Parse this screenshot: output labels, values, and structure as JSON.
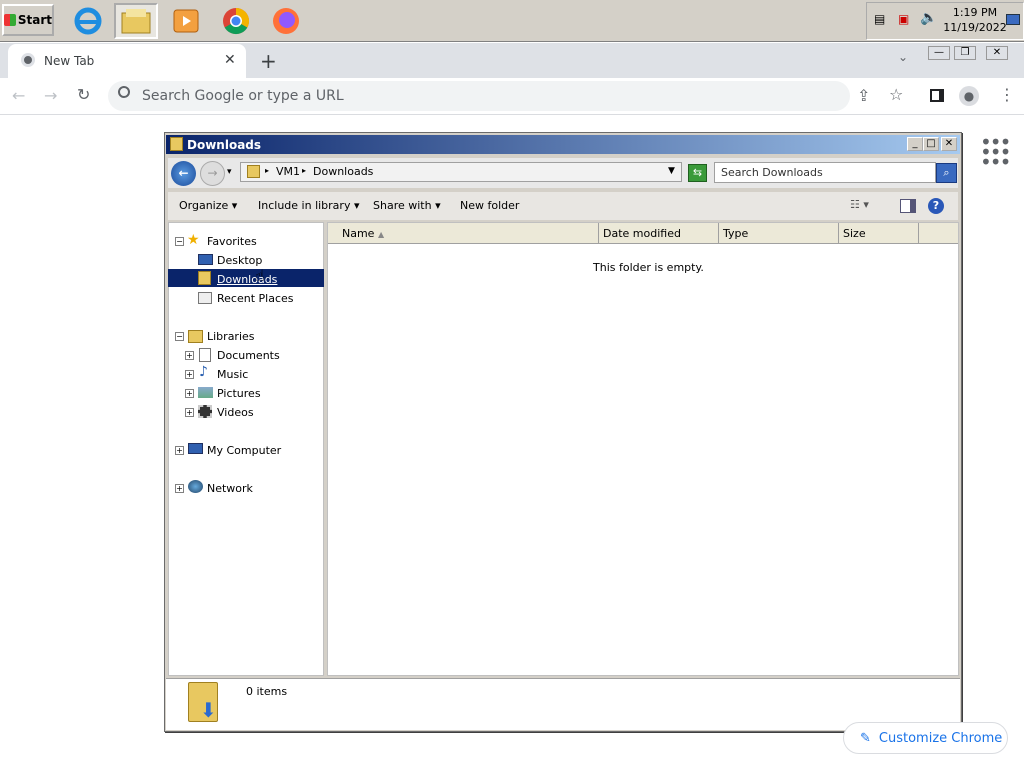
{
  "taskbar": {
    "start_label": "Start",
    "time": "1:19 PM",
    "date": "11/19/2022"
  },
  "chrome": {
    "tab_title": "New Tab",
    "omnibox_placeholder": "Search Google or type a URL",
    "customize_label": "Customize Chrome"
  },
  "explorer": {
    "title": "Downloads",
    "breadcrumb": [
      "VM1",
      "Downloads"
    ],
    "search_placeholder": "Search Downloads",
    "commands": [
      "Organize",
      "Include in library",
      "Share with",
      "New folder"
    ],
    "columns": [
      "Name",
      "Date modified",
      "Type",
      "Size"
    ],
    "empty_message": "This folder is empty.",
    "favorites_label": "Favorites",
    "favorites": [
      "Desktop",
      "Downloads",
      "Recent Places"
    ],
    "libraries_label": "Libraries",
    "libraries": [
      "Documents",
      "Music",
      "Pictures",
      "Videos"
    ],
    "computer_label": "My Computer",
    "network_label": "Network",
    "item_count": "0 items"
  }
}
